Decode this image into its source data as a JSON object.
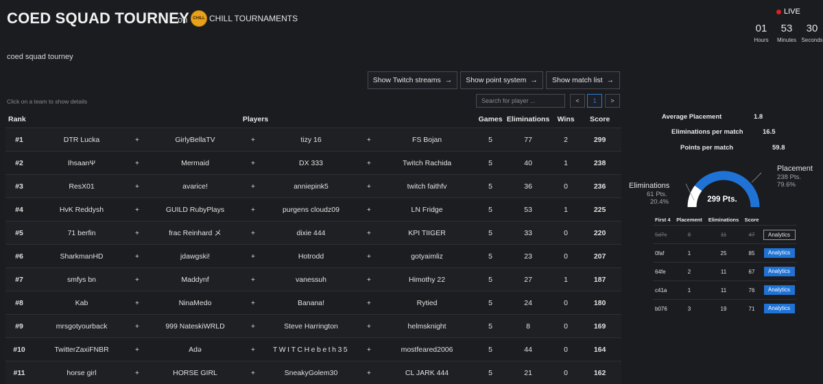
{
  "header": {
    "title": "COED SQUAD TOURNEY",
    "on_text": "on",
    "organizer": "CHILL TOURNAMENTS",
    "organizer_logo_text": "CHILL",
    "live_label": "LIVE"
  },
  "timer": [
    {
      "value": "01",
      "label": "Hours"
    },
    {
      "value": "53",
      "label": "Minutes"
    },
    {
      "value": "30",
      "label": "Seconds"
    }
  ],
  "description": "coed squad tourney",
  "buttons": {
    "twitch": "Show Twitch streams",
    "points": "Show point system",
    "matches": "Show match list",
    "arrow": "→"
  },
  "hint": "Click on a team to show details",
  "search": {
    "placeholder": "Search for player ..."
  },
  "pagination": {
    "prev": "<",
    "current": "1",
    "next": ">"
  },
  "table": {
    "headers": {
      "rank": "Rank",
      "players": "Players",
      "games": "Games",
      "eliminations": "Eliminations",
      "wins": "Wins",
      "score": "Score"
    },
    "plus": "+",
    "rows": [
      {
        "rank": "#1",
        "p1": "DTR Lucka",
        "p2": "GirlyBellaTV",
        "p3": "tizy 16",
        "p4": "FS Bojan",
        "games": "5",
        "elims": "77",
        "wins": "2",
        "score": "299"
      },
      {
        "rank": "#2",
        "p1": "IhsaanΨ",
        "p2": "Mermaid",
        "p3": "DX 333",
        "p4": "Twitch Rachida",
        "games": "5",
        "elims": "40",
        "wins": "1",
        "score": "238"
      },
      {
        "rank": "#3",
        "p1": "ResX01",
        "p2": "avarice!",
        "p3": "anniepink5",
        "p4": "twitch faithfv",
        "games": "5",
        "elims": "36",
        "wins": "0",
        "score": "236"
      },
      {
        "rank": "#4",
        "p1": "HvK Reddysh",
        "p2": "GUILD RubyPlays",
        "p3": "purgens cloudz09",
        "p4": "LN Fridge",
        "games": "5",
        "elims": "53",
        "wins": "1",
        "score": "225"
      },
      {
        "rank": "#5",
        "p1": "71 berfin",
        "p2": "frac Reinhard メ",
        "p3": "dixie 444",
        "p4": "KPI TIIGER",
        "games": "5",
        "elims": "33",
        "wins": "0",
        "score": "220"
      },
      {
        "rank": "#6",
        "p1": "SharkmanHD",
        "p2": "jdawgski!",
        "p3": "Hotrodd",
        "p4": "gotyaimliz",
        "games": "5",
        "elims": "23",
        "wins": "0",
        "score": "207"
      },
      {
        "rank": "#7",
        "p1": "smfys bn",
        "p2": "Maddynf",
        "p3": "vanessuh",
        "p4": "Himothy 22",
        "games": "5",
        "elims": "27",
        "wins": "1",
        "score": "187"
      },
      {
        "rank": "#8",
        "p1": "Kab",
        "p2": "NinaMedo",
        "p3": "Banana!",
        "p4": "Rytied",
        "games": "5",
        "elims": "24",
        "wins": "0",
        "score": "180"
      },
      {
        "rank": "#9",
        "p1": "mrsgotyourback",
        "p2": "999 NateskiWRLD",
        "p3": "Steve Harrington",
        "p4": "helmsknight",
        "games": "5",
        "elims": "8",
        "wins": "0",
        "score": "169"
      },
      {
        "rank": "#10",
        "p1": "TwitterZaxiFNBR",
        "p2": "Adə",
        "p3": "TWITCHebeth35",
        "p4": "mostfeared2006",
        "games": "5",
        "elims": "44",
        "wins": "0",
        "score": "164"
      },
      {
        "rank": "#11",
        "p1": "horse girl",
        "p2": "HORSE GIRL",
        "p3": "SneakyGolem30",
        "p4": "CL JARK 444",
        "games": "5",
        "elims": "21",
        "wins": "0",
        "score": "162"
      }
    ]
  },
  "team_stats": [
    {
      "label": "Average Placement",
      "value": "1.8"
    },
    {
      "label": "Eliminations per match",
      "value": "16.5"
    },
    {
      "label": "Points per match",
      "value": "59.8"
    }
  ],
  "gauge": {
    "total": "299 Pts.",
    "eliminations": {
      "label": "Eliminations",
      "pts": "61 Pts.",
      "pct": "20.4%",
      "fraction": 0.204
    },
    "placement": {
      "label": "Placement",
      "pts": "238 Pts.",
      "pct": "79.6%",
      "fraction": 0.796
    },
    "colors": {
      "placement": "#1f73d6",
      "eliminations": "#ffffff"
    }
  },
  "matches": {
    "headers": {
      "id": "First 4",
      "placement": "Placement",
      "eliminations": "Eliminations",
      "score": "Score"
    },
    "analytics_label": "Analytics",
    "rows": [
      {
        "id": "5d7c",
        "placement": "8",
        "eliminations": "11",
        "score": "47",
        "counted": false
      },
      {
        "id": "0faf",
        "placement": "1",
        "eliminations": "25",
        "score": "85",
        "counted": true
      },
      {
        "id": "64fe",
        "placement": "2",
        "eliminations": "11",
        "score": "67",
        "counted": true
      },
      {
        "id": "c41a",
        "placement": "1",
        "eliminations": "11",
        "score": "76",
        "counted": true
      },
      {
        "id": "b076",
        "placement": "3",
        "eliminations": "19",
        "score": "71",
        "counted": true
      }
    ]
  }
}
